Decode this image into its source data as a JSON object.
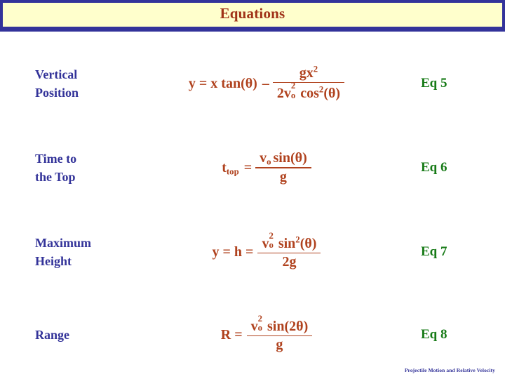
{
  "slide": {
    "title": "Equations",
    "footer": "Projectile Motion and Relative Velocity",
    "colors": {
      "title_text": "#a03318",
      "banner_fill": "#ffffcc",
      "banner_border": "#33339a",
      "label_text": "#333399",
      "formula_text": "#b0421e",
      "tag_text": "#167a16",
      "background": "#ffffff"
    }
  },
  "rows": [
    {
      "label": "Vertical Position",
      "label_line1": "Vertical",
      "label_line2": "Position",
      "tag": "Eq 5",
      "formula_plain": "y = x tan(θ) − gx² / (2vₒ² cos²(θ))",
      "lhs": "y = x tan(θ)",
      "operator": "–",
      "numerator": "gx",
      "numerator_sup": "2",
      "denominator_lead": "2v",
      "denominator_v_sup": "2",
      "denominator_v_sub": "o",
      "denominator_fn": "cos",
      "denominator_fn_sup": "2",
      "denominator_arg": "(θ)"
    },
    {
      "label": "Time to the Top",
      "label_line1": "Time to",
      "label_line2": "the Top",
      "tag": "Eq 6",
      "formula_plain": "t_top = vₒ sin(θ) / g",
      "lhs_base": "t",
      "lhs_sub": "top",
      "equals": "=",
      "numerator_lead": "v",
      "numerator_v_sub": "o",
      "numerator_fn": "sin",
      "numerator_arg": "(θ)",
      "denominator": "g"
    },
    {
      "label": "Maximum Height",
      "label_line1": "Maximum",
      "label_line2": "Height",
      "tag": "Eq 7",
      "formula_plain": "y = h = vₒ² sin²(θ) / 2g",
      "lhs": "y = h =",
      "numerator_lead": "v",
      "numerator_v_sup": "2",
      "numerator_v_sub": "o",
      "numerator_fn": "sin",
      "numerator_fn_sup": "2",
      "numerator_arg": "(θ)",
      "denominator": "2g"
    },
    {
      "label": "Range",
      "label_line1": "Range",
      "label_line2": "",
      "tag": "Eq 8",
      "formula_plain": "R = vₒ² sin(2θ) / g",
      "lhs": "R =",
      "numerator_lead": "v",
      "numerator_v_sup": "2",
      "numerator_v_sub": "o",
      "numerator_fn": "sin",
      "numerator_arg": "(2θ)",
      "denominator": "g"
    }
  ]
}
